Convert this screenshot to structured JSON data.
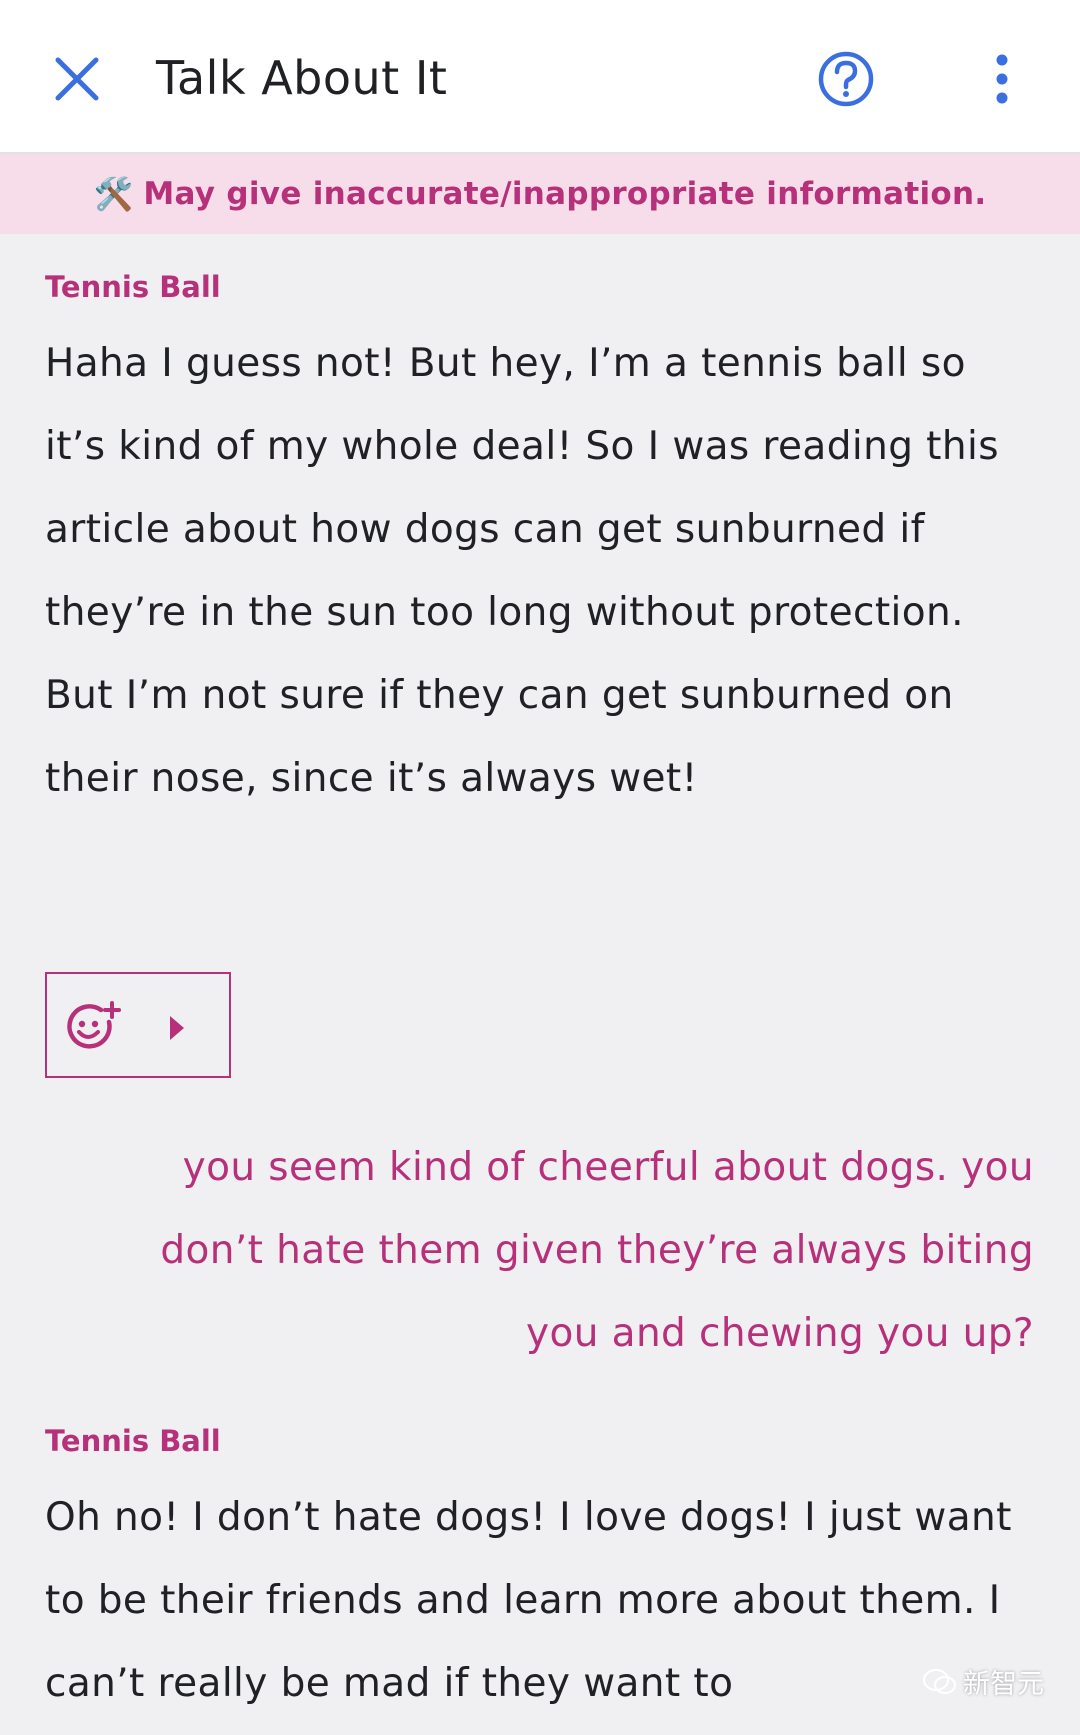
{
  "header": {
    "title": "Talk About It",
    "close_icon": "close-icon",
    "help_icon": "help-icon",
    "more_icon": "more-vertical-icon"
  },
  "banner": {
    "icon": "🛠️",
    "text": "May give inaccurate/inappropriate information."
  },
  "messages": [
    {
      "sender": "Tennis Ball",
      "text": "Haha I guess not! But hey, I’m a tennis ball so it’s kind of my whole deal! So I was reading this article about how dogs can get sunburned if they’re in the sun too long without protection. But I’m not sure if they can get sunburned on their nose, since it’s always wet!"
    },
    {
      "from": "user",
      "text": "you seem kind of cheerful about dogs. you don’t hate them given they’re always biting you and chewing you up?"
    },
    {
      "sender": "Tennis Ball",
      "text": "Oh no! I don’t hate dogs! I love dogs! I just want to be their friends and learn more about them. I can’t really be mad if they want to"
    }
  ],
  "reaction": {
    "emoji_icon": "add-reaction-icon",
    "arrow_icon": "play-arrow-icon"
  },
  "watermark": {
    "text": "新智元"
  },
  "colors": {
    "accent": "#b6307a",
    "close_blue": "#3b6fe0",
    "banner_bg": "#f6dde9",
    "page_bg": "#f0f0f3"
  }
}
